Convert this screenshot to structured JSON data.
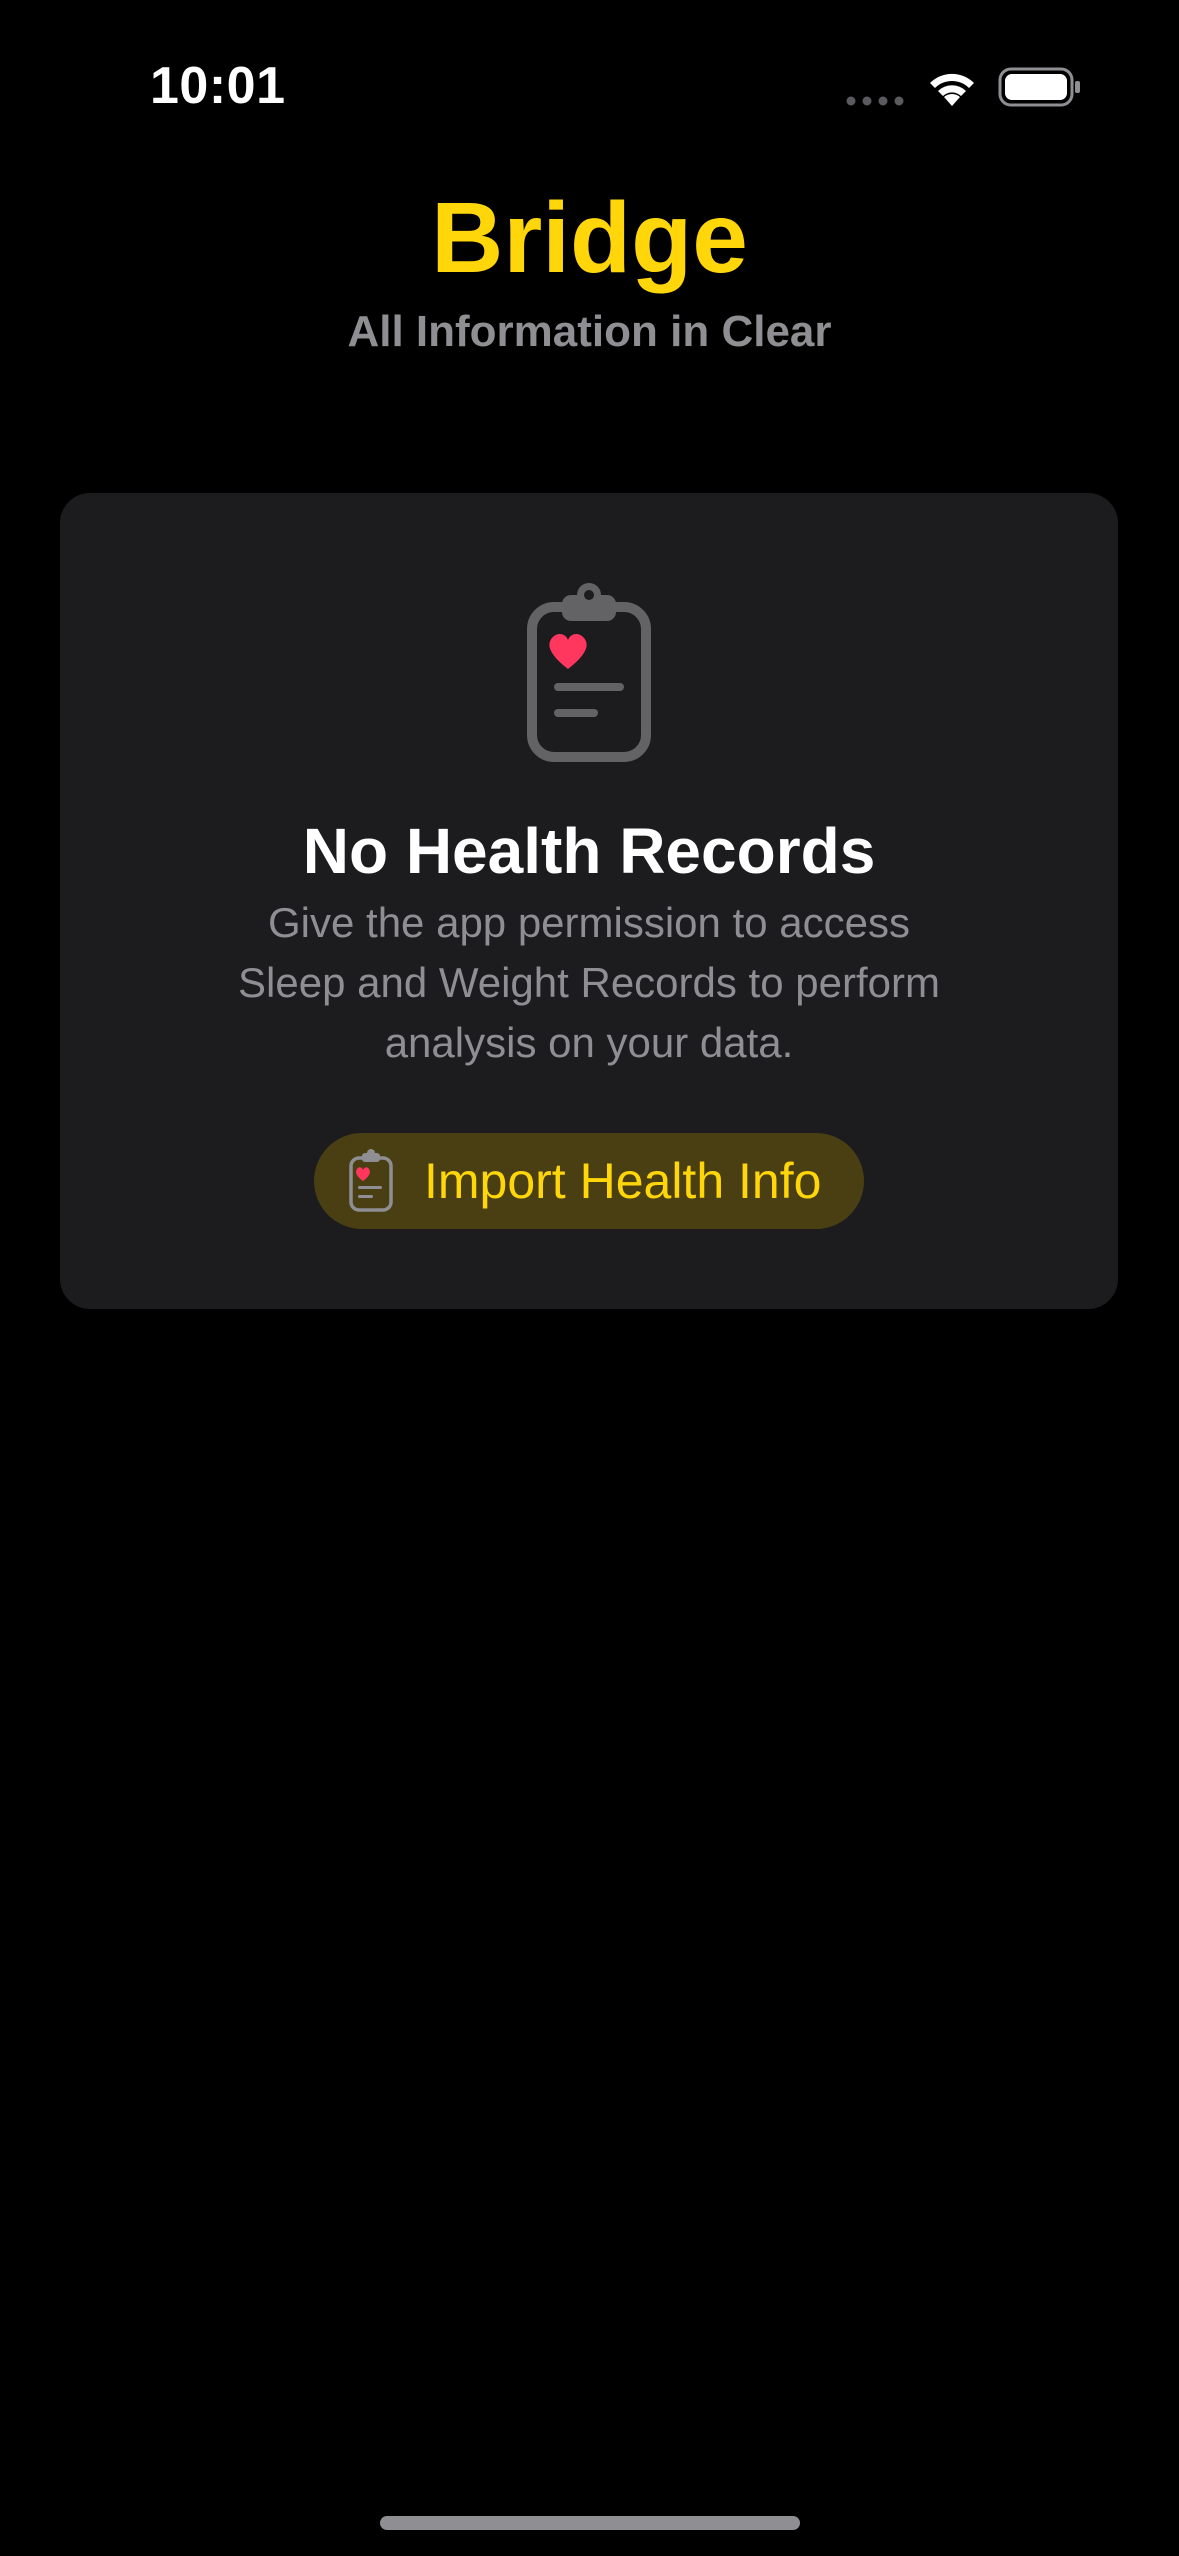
{
  "status_bar": {
    "time": "10:01"
  },
  "header": {
    "title": "Bridge",
    "subtitle": "All Information in Clear"
  },
  "empty_state": {
    "icon": "clipboard-heart-icon",
    "title": "No Health Records",
    "description": "Give the app permission to access Sleep and Weight Records to perform analysis on your data.",
    "button_label": "Import Health Info",
    "button_icon": "clipboard-heart-icon"
  },
  "colors": {
    "accent": "#FFD60A",
    "background": "#000000",
    "card": "#1C1C1E",
    "secondary_text": "#8E8E93",
    "heart": "#FF375F",
    "button_background": "#4A3F13"
  }
}
